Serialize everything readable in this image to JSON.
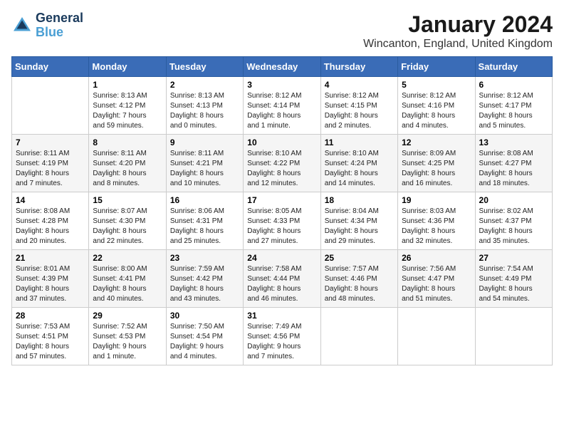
{
  "logo": {
    "line1": "General",
    "line2": "Blue"
  },
  "title": "January 2024",
  "location": "Wincanton, England, United Kingdom",
  "weekdays": [
    "Sunday",
    "Monday",
    "Tuesday",
    "Wednesday",
    "Thursday",
    "Friday",
    "Saturday"
  ],
  "weeks": [
    [
      {
        "day": "",
        "info": ""
      },
      {
        "day": "1",
        "info": "Sunrise: 8:13 AM\nSunset: 4:12 PM\nDaylight: 7 hours\nand 59 minutes."
      },
      {
        "day": "2",
        "info": "Sunrise: 8:13 AM\nSunset: 4:13 PM\nDaylight: 8 hours\nand 0 minutes."
      },
      {
        "day": "3",
        "info": "Sunrise: 8:12 AM\nSunset: 4:14 PM\nDaylight: 8 hours\nand 1 minute."
      },
      {
        "day": "4",
        "info": "Sunrise: 8:12 AM\nSunset: 4:15 PM\nDaylight: 8 hours\nand 2 minutes."
      },
      {
        "day": "5",
        "info": "Sunrise: 8:12 AM\nSunset: 4:16 PM\nDaylight: 8 hours\nand 4 minutes."
      },
      {
        "day": "6",
        "info": "Sunrise: 8:12 AM\nSunset: 4:17 PM\nDaylight: 8 hours\nand 5 minutes."
      }
    ],
    [
      {
        "day": "7",
        "info": "Sunrise: 8:11 AM\nSunset: 4:19 PM\nDaylight: 8 hours\nand 7 minutes."
      },
      {
        "day": "8",
        "info": "Sunrise: 8:11 AM\nSunset: 4:20 PM\nDaylight: 8 hours\nand 8 minutes."
      },
      {
        "day": "9",
        "info": "Sunrise: 8:11 AM\nSunset: 4:21 PM\nDaylight: 8 hours\nand 10 minutes."
      },
      {
        "day": "10",
        "info": "Sunrise: 8:10 AM\nSunset: 4:22 PM\nDaylight: 8 hours\nand 12 minutes."
      },
      {
        "day": "11",
        "info": "Sunrise: 8:10 AM\nSunset: 4:24 PM\nDaylight: 8 hours\nand 14 minutes."
      },
      {
        "day": "12",
        "info": "Sunrise: 8:09 AM\nSunset: 4:25 PM\nDaylight: 8 hours\nand 16 minutes."
      },
      {
        "day": "13",
        "info": "Sunrise: 8:08 AM\nSunset: 4:27 PM\nDaylight: 8 hours\nand 18 minutes."
      }
    ],
    [
      {
        "day": "14",
        "info": "Sunrise: 8:08 AM\nSunset: 4:28 PM\nDaylight: 8 hours\nand 20 minutes."
      },
      {
        "day": "15",
        "info": "Sunrise: 8:07 AM\nSunset: 4:30 PM\nDaylight: 8 hours\nand 22 minutes."
      },
      {
        "day": "16",
        "info": "Sunrise: 8:06 AM\nSunset: 4:31 PM\nDaylight: 8 hours\nand 25 minutes."
      },
      {
        "day": "17",
        "info": "Sunrise: 8:05 AM\nSunset: 4:33 PM\nDaylight: 8 hours\nand 27 minutes."
      },
      {
        "day": "18",
        "info": "Sunrise: 8:04 AM\nSunset: 4:34 PM\nDaylight: 8 hours\nand 29 minutes."
      },
      {
        "day": "19",
        "info": "Sunrise: 8:03 AM\nSunset: 4:36 PM\nDaylight: 8 hours\nand 32 minutes."
      },
      {
        "day": "20",
        "info": "Sunrise: 8:02 AM\nSunset: 4:37 PM\nDaylight: 8 hours\nand 35 minutes."
      }
    ],
    [
      {
        "day": "21",
        "info": "Sunrise: 8:01 AM\nSunset: 4:39 PM\nDaylight: 8 hours\nand 37 minutes."
      },
      {
        "day": "22",
        "info": "Sunrise: 8:00 AM\nSunset: 4:41 PM\nDaylight: 8 hours\nand 40 minutes."
      },
      {
        "day": "23",
        "info": "Sunrise: 7:59 AM\nSunset: 4:42 PM\nDaylight: 8 hours\nand 43 minutes."
      },
      {
        "day": "24",
        "info": "Sunrise: 7:58 AM\nSunset: 4:44 PM\nDaylight: 8 hours\nand 46 minutes."
      },
      {
        "day": "25",
        "info": "Sunrise: 7:57 AM\nSunset: 4:46 PM\nDaylight: 8 hours\nand 48 minutes."
      },
      {
        "day": "26",
        "info": "Sunrise: 7:56 AM\nSunset: 4:47 PM\nDaylight: 8 hours\nand 51 minutes."
      },
      {
        "day": "27",
        "info": "Sunrise: 7:54 AM\nSunset: 4:49 PM\nDaylight: 8 hours\nand 54 minutes."
      }
    ],
    [
      {
        "day": "28",
        "info": "Sunrise: 7:53 AM\nSunset: 4:51 PM\nDaylight: 8 hours\nand 57 minutes."
      },
      {
        "day": "29",
        "info": "Sunrise: 7:52 AM\nSunset: 4:53 PM\nDaylight: 9 hours\nand 1 minute."
      },
      {
        "day": "30",
        "info": "Sunrise: 7:50 AM\nSunset: 4:54 PM\nDaylight: 9 hours\nand 4 minutes."
      },
      {
        "day": "31",
        "info": "Sunrise: 7:49 AM\nSunset: 4:56 PM\nDaylight: 9 hours\nand 7 minutes."
      },
      {
        "day": "",
        "info": ""
      },
      {
        "day": "",
        "info": ""
      },
      {
        "day": "",
        "info": ""
      }
    ]
  ]
}
